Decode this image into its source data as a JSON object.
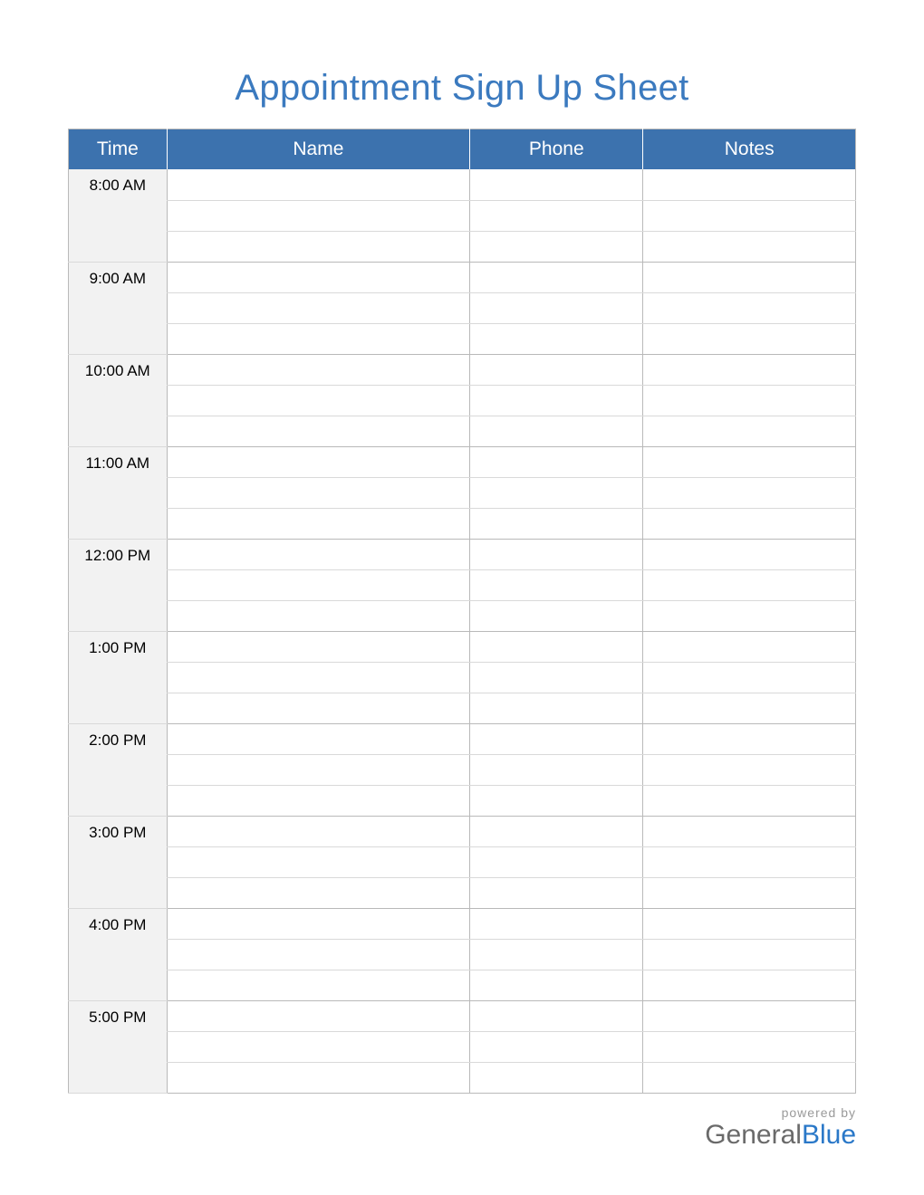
{
  "title": "Appointment Sign Up Sheet",
  "columns": {
    "time": "Time",
    "name": "Name",
    "phone": "Phone",
    "notes": "Notes"
  },
  "slots_per_block": 3,
  "time_blocks": [
    {
      "time": "8:00 AM",
      "entries": [
        {
          "name": "",
          "phone": "",
          "notes": ""
        },
        {
          "name": "",
          "phone": "",
          "notes": ""
        },
        {
          "name": "",
          "phone": "",
          "notes": ""
        }
      ]
    },
    {
      "time": "9:00 AM",
      "entries": [
        {
          "name": "",
          "phone": "",
          "notes": ""
        },
        {
          "name": "",
          "phone": "",
          "notes": ""
        },
        {
          "name": "",
          "phone": "",
          "notes": ""
        }
      ]
    },
    {
      "time": "10:00 AM",
      "entries": [
        {
          "name": "",
          "phone": "",
          "notes": ""
        },
        {
          "name": "",
          "phone": "",
          "notes": ""
        },
        {
          "name": "",
          "phone": "",
          "notes": ""
        }
      ]
    },
    {
      "time": "11:00 AM",
      "entries": [
        {
          "name": "",
          "phone": "",
          "notes": ""
        },
        {
          "name": "",
          "phone": "",
          "notes": ""
        },
        {
          "name": "",
          "phone": "",
          "notes": ""
        }
      ]
    },
    {
      "time": "12:00 PM",
      "entries": [
        {
          "name": "",
          "phone": "",
          "notes": ""
        },
        {
          "name": "",
          "phone": "",
          "notes": ""
        },
        {
          "name": "",
          "phone": "",
          "notes": ""
        }
      ]
    },
    {
      "time": "1:00 PM",
      "entries": [
        {
          "name": "",
          "phone": "",
          "notes": ""
        },
        {
          "name": "",
          "phone": "",
          "notes": ""
        },
        {
          "name": "",
          "phone": "",
          "notes": ""
        }
      ]
    },
    {
      "time": "2:00 PM",
      "entries": [
        {
          "name": "",
          "phone": "",
          "notes": ""
        },
        {
          "name": "",
          "phone": "",
          "notes": ""
        },
        {
          "name": "",
          "phone": "",
          "notes": ""
        }
      ]
    },
    {
      "time": "3:00 PM",
      "entries": [
        {
          "name": "",
          "phone": "",
          "notes": ""
        },
        {
          "name": "",
          "phone": "",
          "notes": ""
        },
        {
          "name": "",
          "phone": "",
          "notes": ""
        }
      ]
    },
    {
      "time": "4:00 PM",
      "entries": [
        {
          "name": "",
          "phone": "",
          "notes": ""
        },
        {
          "name": "",
          "phone": "",
          "notes": ""
        },
        {
          "name": "",
          "phone": "",
          "notes": ""
        }
      ]
    },
    {
      "time": "5:00 PM",
      "entries": [
        {
          "name": "",
          "phone": "",
          "notes": ""
        },
        {
          "name": "",
          "phone": "",
          "notes": ""
        },
        {
          "name": "",
          "phone": "",
          "notes": ""
        }
      ]
    }
  ],
  "footer": {
    "powered_by": "powered by",
    "brand_general": "General",
    "brand_blue": "Blue"
  },
  "colors": {
    "header_bg": "#3C72AE",
    "title_color": "#3B7ABF",
    "time_bg": "#f2f2f2",
    "brand_accent": "#2a78c8"
  }
}
